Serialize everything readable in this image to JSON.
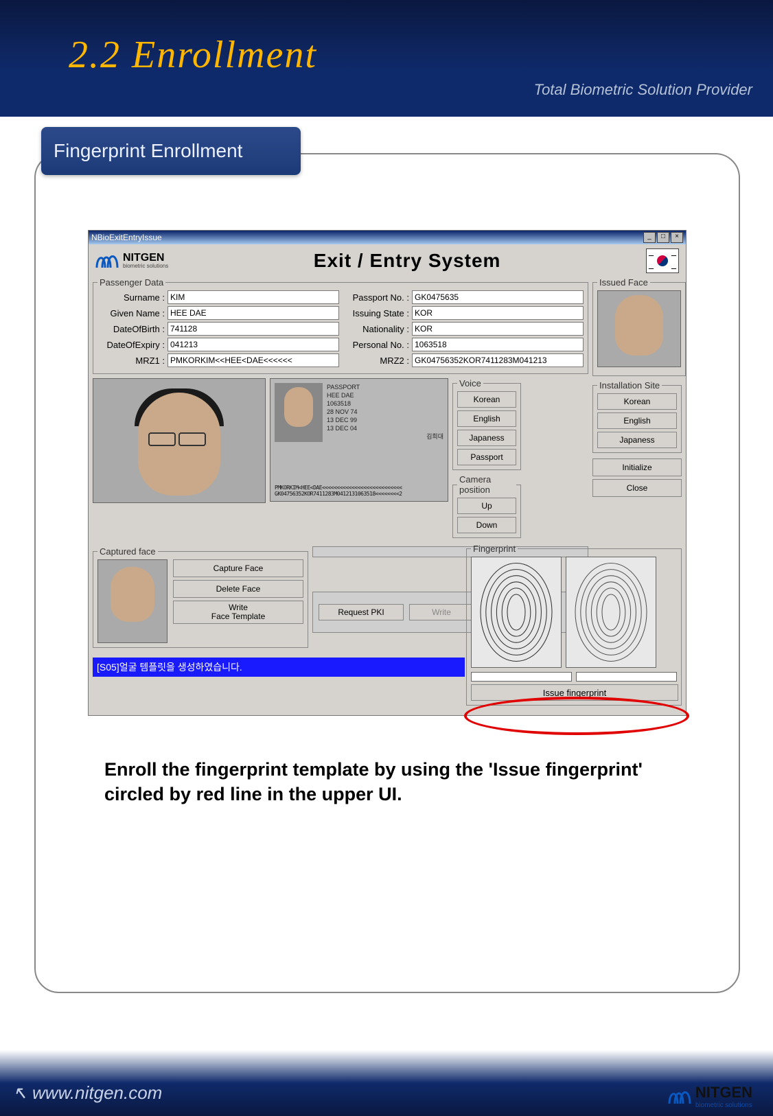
{
  "page_title": "2.2 Enrollment",
  "tagline": "Total Biometric Solution Provider",
  "badge": "Fingerprint  Enrollment",
  "app": {
    "titlebar": "NBioExitEntryIssue",
    "brand": "NITGEN",
    "brand_sub": "biometric solutions",
    "system_title": "Exit / Entry System",
    "passenger_data_legend": "Passenger Data",
    "fields": {
      "surname_label": "Surname :",
      "surname": "KIM",
      "given_label": "Given Name :",
      "given": "HEE DAE",
      "dob_label": "DateOfBirth :",
      "dob": "741128",
      "doe_label": "DateOfExpiry :",
      "doe": "041213",
      "mrz1_label": "MRZ1 :",
      "mrz1": "PMKORKIM<<HEE<DAE<<<<<<",
      "passno_label": "Passport No. :",
      "passno": "GK0475635",
      "issuing_label": "Issuing State :",
      "issuing": "KOR",
      "nat_label": "Nationality :",
      "nat": "KOR",
      "personal_label": "Personal No. :",
      "personal": "1063518",
      "mrz2_label": "MRZ2 :",
      "mrz2": "GK04756352KOR7411283M041213"
    },
    "passport_ocr": {
      "header": "PASSPORT",
      "name": "HEE DAE",
      "num": "1063518",
      "date1": "28 NOV 74",
      "date2": "13 DEC 99",
      "date3": "13 DEC 04",
      "kname": "김희대",
      "mrz_a": "PMKORKIM<HEE<DAE<<<<<<<<<<<<<<<<<<<<<<<<<<<",
      "mrz_b": "GK04756352KOR7411283M0412131063518<<<<<<<<2"
    },
    "issued_face_legend": "Issued Face",
    "voice_legend": "Voice",
    "voice": {
      "korean": "Korean",
      "english": "English",
      "japanese": "Japaness",
      "passport": "Passport"
    },
    "install_legend": "Installation Site",
    "install": {
      "korean": "Korean",
      "english": "English",
      "japanese": "Japaness"
    },
    "camera_legend": "Camera position",
    "camera": {
      "up": "Up",
      "down": "Down"
    },
    "initialize": "Initialize",
    "close": "Close",
    "captured_legend": "Captured face",
    "capture_face": "Capture Face",
    "delete_face": "Delete Face",
    "write_face": "Write\nFace Template",
    "request_pki": "Request PKI",
    "write": "Write",
    "fingerprint_legend": "Fingerprint",
    "issue_fp": "Issue fingerprint",
    "status": "[S05]얼굴 템플릿을 생성하였습니다."
  },
  "instruction": "Enroll the fingerprint template by using the 'Issue fingerprint' circled by red line in the upper UI.",
  "footer": {
    "url": "www.nitgen.com",
    "brand": "NITGEN",
    "brand_sub": "biometric solutions"
  }
}
